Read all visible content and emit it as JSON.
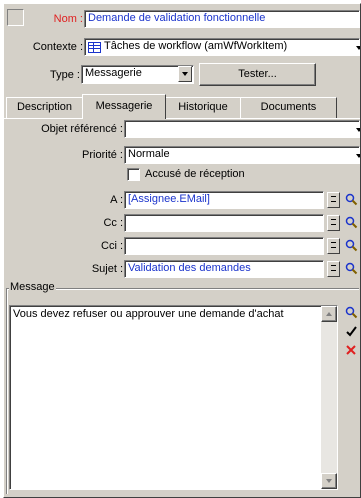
{
  "header": {
    "nom_label": "Nom :",
    "nom_value": "Demande de validation fonctionnelle",
    "contexte_label": "Contexte :",
    "contexte_value": "Tâches de workflow (amWfWorkItem)",
    "type_label": "Type :",
    "type_value": "Messagerie",
    "tester_label": "Tester..."
  },
  "tabs": [
    {
      "label": "Description",
      "active": false
    },
    {
      "label": "Messagerie",
      "active": true
    },
    {
      "label": "Historique",
      "active": false
    },
    {
      "label": "Documents",
      "active": false
    }
  ],
  "form": {
    "objet_label": "Objet référencé :",
    "objet_value": "",
    "priorite_label": "Priorité :",
    "priorite_value": "Normale",
    "accuse_label": "Accusé de réception",
    "accuse_checked": false,
    "a_label": "A :",
    "a_value": "[Assignee.EMail]",
    "cc_label": "Cc :",
    "cc_value": "",
    "cci_label": "Cci :",
    "cci_value": "",
    "sujet_label": "Sujet :",
    "sujet_value": "Validation des demandes"
  },
  "message": {
    "group_label": "Message",
    "text": "Vous devez refuser ou approuver une demande d'achat"
  },
  "colors": {
    "face": "#d4d0c8",
    "value_blue": "#1a33cc",
    "label_red": "#e02020",
    "delete_red": "#e02020"
  },
  "icons": {
    "contexte": "table-icon",
    "lookup": "magnifier-icon",
    "validate": "checkmark-icon",
    "delete": "cross-icon"
  }
}
